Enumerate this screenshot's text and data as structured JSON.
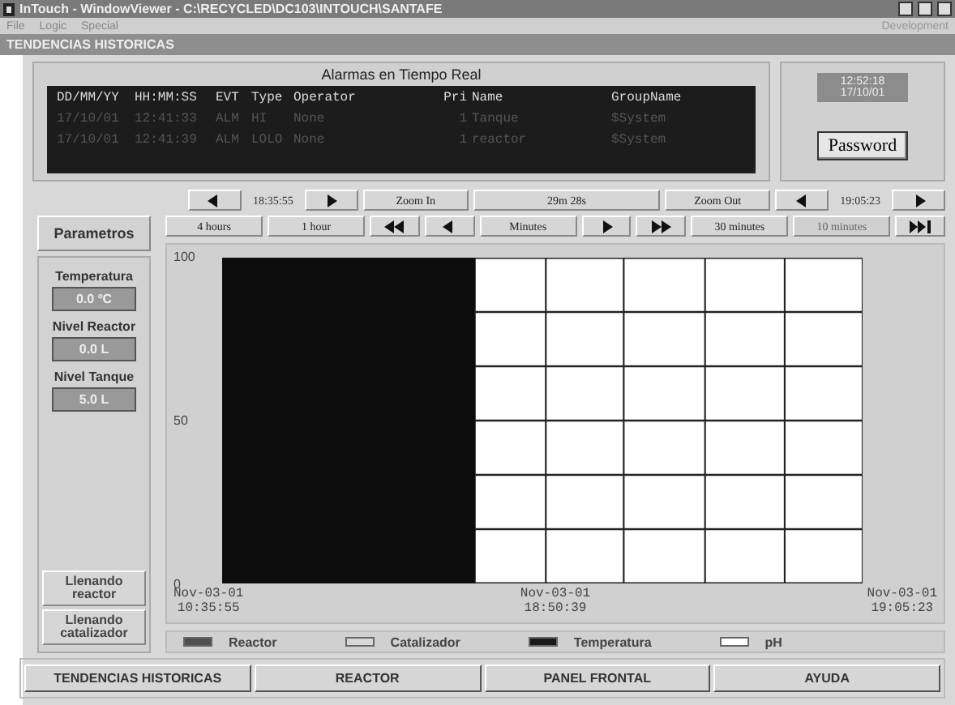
{
  "window": {
    "title": "InTouch - WindowViewer - C:\\RECYCLED\\DC103\\INTOUCH\\SANTAFE",
    "mode": "Development"
  },
  "menu": [
    "File",
    "Logic",
    "Special"
  ],
  "section_title": "TENDENCIAS HISTORICAS",
  "alarms": {
    "title": "Alarmas en Tiempo Real",
    "columns": [
      "DD/MM/YY",
      "HH:MM:SS",
      "EVT",
      "Type",
      "Operator",
      "Pri",
      "Name",
      "GroupName"
    ],
    "rows": [
      [
        "17/10/01",
        "12:41:33",
        "ALM",
        "HI",
        "None",
        "1",
        "Tanque",
        "$System"
      ],
      [
        "17/10/01",
        "12:41:39",
        "ALM",
        "LOLO",
        "None",
        "1",
        "reactor",
        "$System"
      ]
    ]
  },
  "clock": {
    "time": "12:52:18",
    "date": "17/10/01"
  },
  "password_button": "Password",
  "time_controls": [
    {
      "kind": "prev"
    },
    {
      "kind": "label",
      "text": "18:35:55"
    },
    {
      "kind": "next"
    },
    {
      "kind": "button",
      "text": "Zoom In"
    },
    {
      "kind": "field",
      "text": "29m 28s"
    },
    {
      "kind": "button",
      "text": "Zoom Out"
    },
    {
      "kind": "prev"
    },
    {
      "kind": "label",
      "text": "19:05:23"
    },
    {
      "kind": "next"
    }
  ],
  "scale_controls": [
    {
      "kind": "button",
      "text": "4 hours",
      "selected": false
    },
    {
      "kind": "button",
      "text": "1 hour",
      "selected": false
    },
    {
      "kind": "fast-back"
    },
    {
      "kind": "prev"
    },
    {
      "kind": "button",
      "text": "Minutes",
      "selected": false
    },
    {
      "kind": "next"
    },
    {
      "kind": "fast-forward"
    },
    {
      "kind": "button",
      "text": "30 minutes",
      "selected": false
    },
    {
      "kind": "button",
      "text": "10 minutes",
      "selected": true
    },
    {
      "kind": "end"
    }
  ],
  "parameters": {
    "title": "Parametros",
    "items": [
      {
        "label": "Temperatura",
        "value": "0.0 ºC"
      },
      {
        "label": "Nivel Reactor",
        "value": "0.0 L"
      },
      {
        "label": "Nivel Tanque",
        "value": "5.0 L"
      }
    ],
    "buttons": [
      "Llenando\nreactor",
      "Llenando\ncatalizador"
    ]
  },
  "trend": {
    "y_ticks": [
      "100",
      "50",
      "0"
    ],
    "x_labels": [
      [
        "Nov-03-01",
        "10:35:55"
      ],
      [
        "Nov-03-01",
        "18:50:39"
      ],
      [
        "Nov-03-01",
        "19:05:23"
      ]
    ]
  },
  "legend": [
    {
      "label": "Reactor",
      "color": "#505050"
    },
    {
      "label": "Catalizador",
      "color": "#d8d8d8"
    },
    {
      "label": "Temperatura",
      "color": "#1a1a1a"
    },
    {
      "label": "pH",
      "color": "#ffffff"
    }
  ],
  "nav": [
    "TENDENCIAS HISTORICAS",
    "REACTOR",
    "PANEL FRONTAL",
    "AYUDA"
  ]
}
